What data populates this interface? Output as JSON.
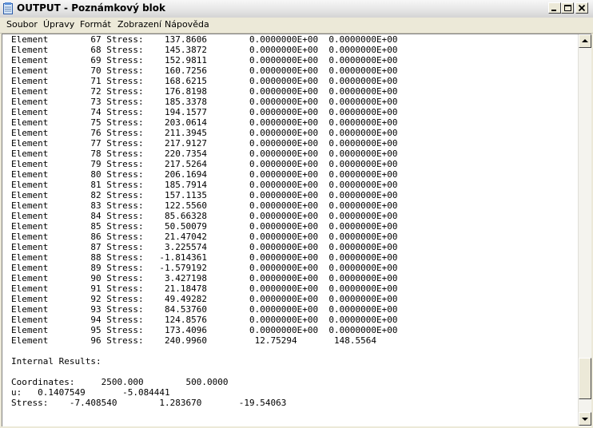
{
  "window": {
    "title": "OUTPUT - Poznámkový blok",
    "icon": "notepad-icon"
  },
  "menu": [
    {
      "label": "Soubor"
    },
    {
      "label": "Úpravy"
    },
    {
      "label": "Formát"
    },
    {
      "label": "Zobrazení"
    },
    {
      "label": "Nápověda"
    }
  ],
  "lines": [
    "Element        67 Stress:    137.8606        0.0000000E+00  0.0000000E+00",
    "Element        68 Stress:    145.3872        0.0000000E+00  0.0000000E+00",
    "Element        69 Stress:    152.9811        0.0000000E+00  0.0000000E+00",
    "Element        70 Stress:    160.7256        0.0000000E+00  0.0000000E+00",
    "Element        71 Stress:    168.6215        0.0000000E+00  0.0000000E+00",
    "Element        72 Stress:    176.8198        0.0000000E+00  0.0000000E+00",
    "Element        73 Stress:    185.3378        0.0000000E+00  0.0000000E+00",
    "Element        74 Stress:    194.1577        0.0000000E+00  0.0000000E+00",
    "Element        75 Stress:    203.0614        0.0000000E+00  0.0000000E+00",
    "Element        76 Stress:    211.3945        0.0000000E+00  0.0000000E+00",
    "Element        77 Stress:    217.9127        0.0000000E+00  0.0000000E+00",
    "Element        78 Stress:    220.7354        0.0000000E+00  0.0000000E+00",
    "Element        79 Stress:    217.5264        0.0000000E+00  0.0000000E+00",
    "Element        80 Stress:    206.1694        0.0000000E+00  0.0000000E+00",
    "Element        81 Stress:    185.7914        0.0000000E+00  0.0000000E+00",
    "Element        82 Stress:    157.1135        0.0000000E+00  0.0000000E+00",
    "Element        83 Stress:    122.5560        0.0000000E+00  0.0000000E+00",
    "Element        84 Stress:    85.66328        0.0000000E+00  0.0000000E+00",
    "Element        85 Stress:    50.50079        0.0000000E+00  0.0000000E+00",
    "Element        86 Stress:    21.47042        0.0000000E+00  0.0000000E+00",
    "Element        87 Stress:    3.225574        0.0000000E+00  0.0000000E+00",
    "Element        88 Stress:   -1.814361        0.0000000E+00  0.0000000E+00",
    "Element        89 Stress:   -1.579192        0.0000000E+00  0.0000000E+00",
    "Element        90 Stress:    3.427198        0.0000000E+00  0.0000000E+00",
    "Element        91 Stress:    21.18478        0.0000000E+00  0.0000000E+00",
    "Element        92 Stress:    49.49282        0.0000000E+00  0.0000000E+00",
    "Element        93 Stress:    84.53760        0.0000000E+00  0.0000000E+00",
    "Element        94 Stress:    124.8576        0.0000000E+00  0.0000000E+00",
    "Element        95 Stress:    173.4096        0.0000000E+00  0.0000000E+00",
    "Element        96 Stress:    240.9960         12.75294       148.5564",
    "",
    "Internal Results:",
    "",
    "Coordinates:     2500.000        500.0000",
    "u:   0.1407549       -5.084441",
    "Stress:    -7.408540        1.283670       -19.54063"
  ],
  "scrollbar": {
    "position": 0.96
  }
}
